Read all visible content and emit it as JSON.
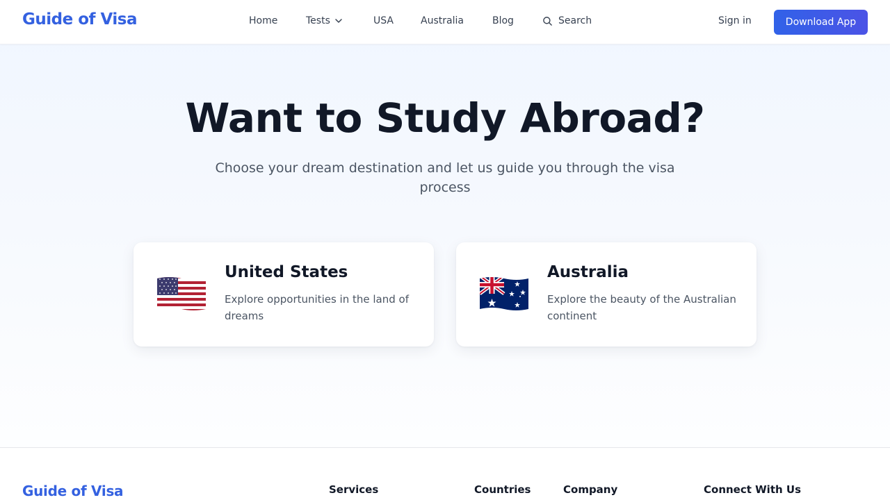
{
  "header": {
    "logo": "Guide of Visa",
    "nav": {
      "home": "Home",
      "tests": "Tests",
      "usa": "USA",
      "australia": "Australia",
      "blog": "Blog",
      "search": "Search"
    },
    "sign_in": "Sign in",
    "download_app": "Download App"
  },
  "hero": {
    "title": "Want to Study Abroad?",
    "subtitle": "Choose your dream destination and let us guide you through the visa process"
  },
  "destinations": [
    {
      "name": "United States",
      "description": "Explore opportunities in the land of dreams",
      "flag_icon": "us-flag-icon"
    },
    {
      "name": "Australia",
      "description": "Explore the beauty of the Australian continent",
      "flag_icon": "australia-flag-icon"
    }
  ],
  "footer": {
    "logo": "Guide of Visa",
    "columns": [
      "Services",
      "Countries",
      "Company",
      "Connect With Us"
    ]
  },
  "colors": {
    "brand": "#3461e0",
    "button": "#3b5be8",
    "text_dark": "#111827",
    "text_muted": "#4b5563"
  }
}
